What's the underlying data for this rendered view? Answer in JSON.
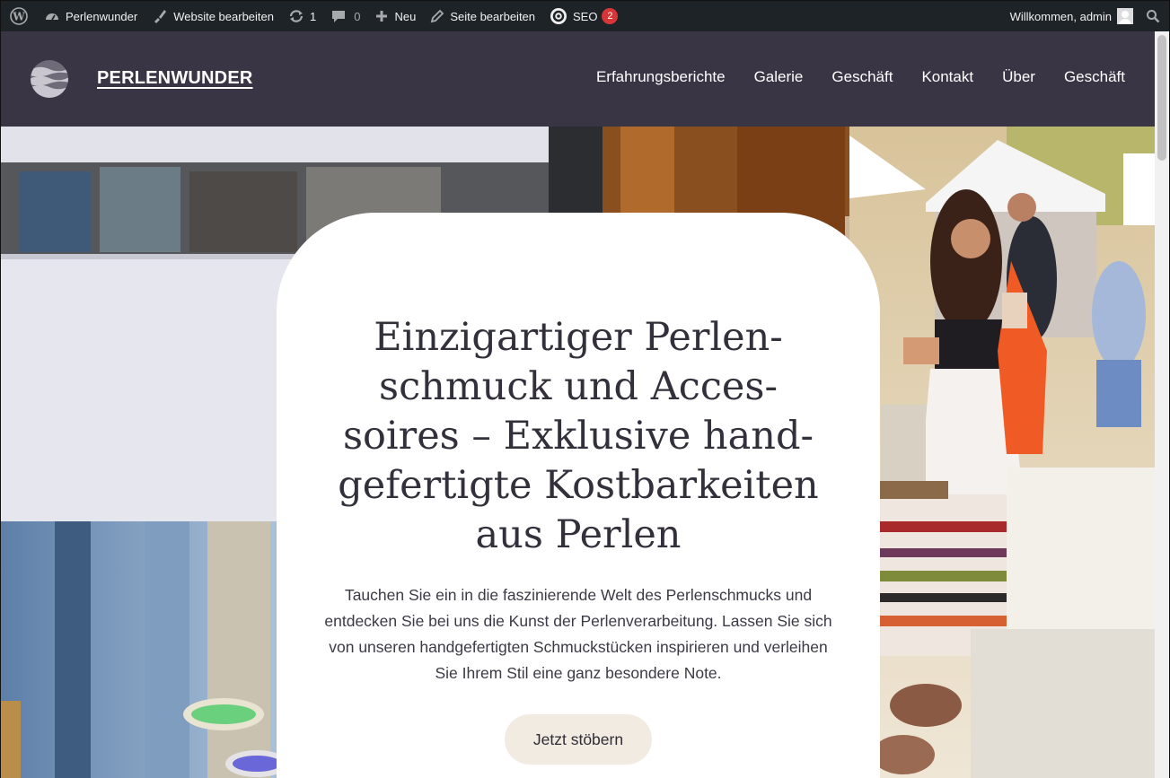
{
  "adminbar": {
    "items": [
      {
        "label": "Perlenwunder",
        "icon": "dashboard-icon"
      },
      {
        "label": "Website bearbeiten",
        "icon": "brush-icon"
      },
      {
        "label": "1",
        "icon": "updates-icon"
      },
      {
        "label": "0",
        "icon": "comments-icon"
      },
      {
        "label": "Neu",
        "icon": "plus-icon"
      },
      {
        "label": "Seite bearbeiten",
        "icon": "pencil-icon"
      },
      {
        "label": "SEO",
        "icon": "seo-icon",
        "badge": "2"
      }
    ],
    "welcome": "Willkommen, admin",
    "colors": {
      "bar": "#1d2327",
      "badge": "#d63638"
    }
  },
  "header": {
    "site_title": "PERLENWUNDER",
    "nav": [
      "Erfahrungsberichte",
      "Galerie",
      "Geschäft",
      "Kontakt",
      "Über",
      "Geschäft"
    ],
    "colors": {
      "background": "#3a3544"
    }
  },
  "hero": {
    "heading": "Einzigartiger Perlen­schmuck und Acces­soires – Exklusive hand­gefertigte Kostbarkeiten aus Perlen",
    "text": "Tauchen Sie ein in die faszinierende Welt des Perlenschmucks und entdecken Sie bei uns die Kunst der Perlenverarbeitung. Lassen Sie sich von unseren handgefertigten Schmuckstücken inspirieren und verleihen Sie Ihrem Stil eine ganz besondere Note.",
    "cta": "Jetzt stöbern",
    "colors": {
      "cta_bg": "#f1ebe1",
      "heading": "#33303b"
    }
  }
}
